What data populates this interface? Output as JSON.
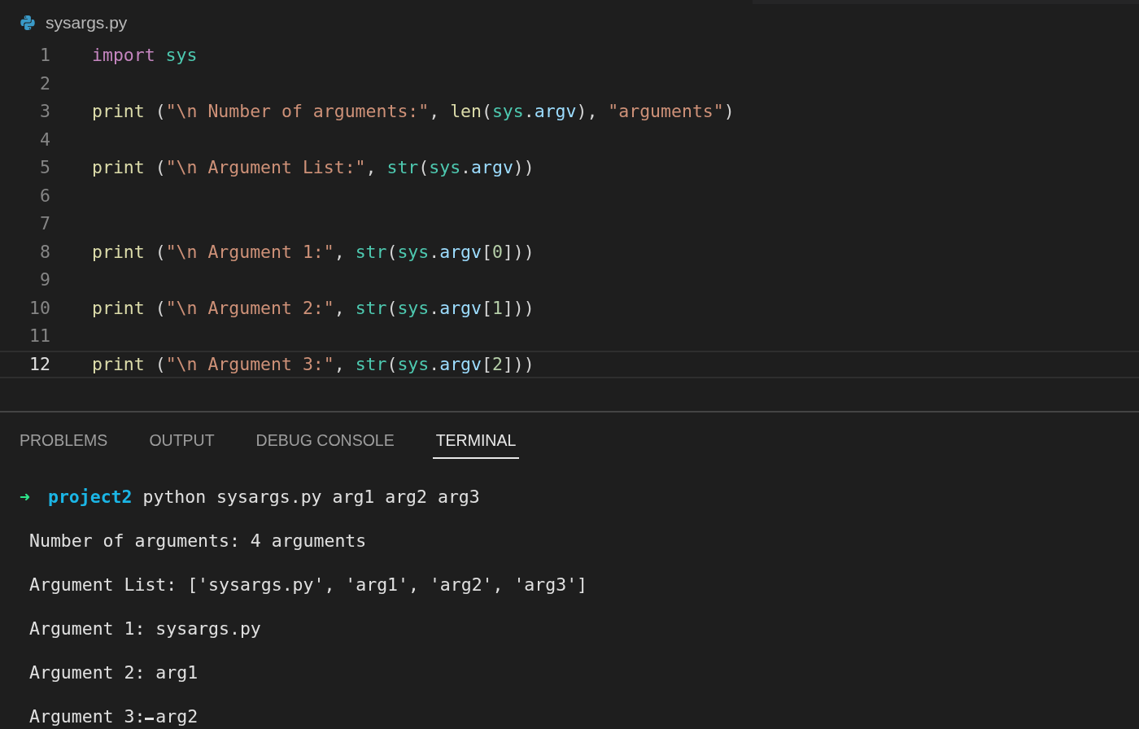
{
  "editor_tab": {
    "title": "sysargs.py"
  },
  "code_lines": [
    {
      "number": "1",
      "current": false,
      "tokens": [
        {
          "text": "import ",
          "kind": "keyword"
        },
        {
          "text": "sys",
          "kind": "module"
        }
      ]
    },
    {
      "number": "2",
      "current": false
    },
    {
      "number": "3",
      "current": false,
      "tokens": [
        {
          "text": "print",
          "kind": "func"
        },
        {
          "text": " (",
          "kind": "punct"
        },
        {
          "text": "\"\\n Number of arguments:\"",
          "kind": "string"
        },
        {
          "text": ", ",
          "kind": "punct"
        },
        {
          "text": "len",
          "kind": "func"
        },
        {
          "text": "(",
          "kind": "punct"
        },
        {
          "text": "sys",
          "kind": "module"
        },
        {
          "text": ".",
          "kind": "punct"
        },
        {
          "text": "argv",
          "kind": "attr"
        },
        {
          "text": "), ",
          "kind": "punct"
        },
        {
          "text": "\"arguments\"",
          "kind": "string"
        },
        {
          "text": ")",
          "kind": "punct"
        }
      ]
    },
    {
      "number": "4",
      "current": false
    },
    {
      "number": "5",
      "current": false,
      "tokens": [
        {
          "text": "print",
          "kind": "func"
        },
        {
          "text": " (",
          "kind": "punct"
        },
        {
          "text": "\"\\n Argument List:\"",
          "kind": "string"
        },
        {
          "text": ", ",
          "kind": "punct"
        },
        {
          "text": "str",
          "kind": "module"
        },
        {
          "text": "(",
          "kind": "punct"
        },
        {
          "text": "sys",
          "kind": "module"
        },
        {
          "text": ".",
          "kind": "punct"
        },
        {
          "text": "argv",
          "kind": "attr"
        },
        {
          "text": "))",
          "kind": "punct"
        }
      ]
    },
    {
      "number": "6",
      "current": false
    },
    {
      "number": "7",
      "current": false
    },
    {
      "number": "8",
      "current": false,
      "tokens": [
        {
          "text": "print",
          "kind": "func"
        },
        {
          "text": " (",
          "kind": "punct"
        },
        {
          "text": "\"\\n Argument 1:\"",
          "kind": "string"
        },
        {
          "text": ", ",
          "kind": "punct"
        },
        {
          "text": "str",
          "kind": "module"
        },
        {
          "text": "(",
          "kind": "punct"
        },
        {
          "text": "sys",
          "kind": "module"
        },
        {
          "text": ".",
          "kind": "punct"
        },
        {
          "text": "argv",
          "kind": "attr"
        },
        {
          "text": "[",
          "kind": "punct"
        },
        {
          "text": "0",
          "kind": "number"
        },
        {
          "text": "]))",
          "kind": "punct"
        }
      ]
    },
    {
      "number": "9",
      "current": false
    },
    {
      "number": "10",
      "current": false,
      "tokens": [
        {
          "text": "print",
          "kind": "func"
        },
        {
          "text": " (",
          "kind": "punct"
        },
        {
          "text": "\"\\n Argument 2:\"",
          "kind": "string"
        },
        {
          "text": ", ",
          "kind": "punct"
        },
        {
          "text": "str",
          "kind": "module"
        },
        {
          "text": "(",
          "kind": "punct"
        },
        {
          "text": "sys",
          "kind": "module"
        },
        {
          "text": ".",
          "kind": "punct"
        },
        {
          "text": "argv",
          "kind": "attr"
        },
        {
          "text": "[",
          "kind": "punct"
        },
        {
          "text": "1",
          "kind": "number"
        },
        {
          "text": "]))",
          "kind": "punct"
        }
      ]
    },
    {
      "number": "11",
      "current": false
    },
    {
      "number": "12",
      "current": true,
      "tokens": [
        {
          "text": "print",
          "kind": "func"
        },
        {
          "text": " (",
          "kind": "punct"
        },
        {
          "text": "\"\\n Argument 3:\"",
          "kind": "string"
        },
        {
          "text": ", ",
          "kind": "punct"
        },
        {
          "text": "str",
          "kind": "module"
        },
        {
          "text": "(",
          "kind": "punct"
        },
        {
          "text": "sys",
          "kind": "module"
        },
        {
          "text": ".",
          "kind": "punct"
        },
        {
          "text": "argv",
          "kind": "attr"
        },
        {
          "text": "[",
          "kind": "punct"
        },
        {
          "text": "2",
          "kind": "number"
        },
        {
          "text": "]))",
          "kind": "punct"
        }
      ]
    }
  ],
  "panel_tabs": [
    {
      "label": "PROBLEMS",
      "selected": false
    },
    {
      "label": "OUTPUT",
      "selected": false
    },
    {
      "label": "DEBUG CONSOLE",
      "selected": false
    },
    {
      "label": "TERMINAL",
      "selected": true
    }
  ],
  "terminal": {
    "prompt": {
      "arrow": "➜",
      "directory": "project2",
      "command": "python sysargs.py arg1 arg2 arg3"
    },
    "output": [
      "Number of arguments: 4 arguments",
      "Argument List: ['sysargs.py', 'arg1', 'arg2', 'arg3']",
      "Argument 1: sysargs.py",
      "Argument 2: arg1",
      "Argument 3: arg2"
    ]
  }
}
